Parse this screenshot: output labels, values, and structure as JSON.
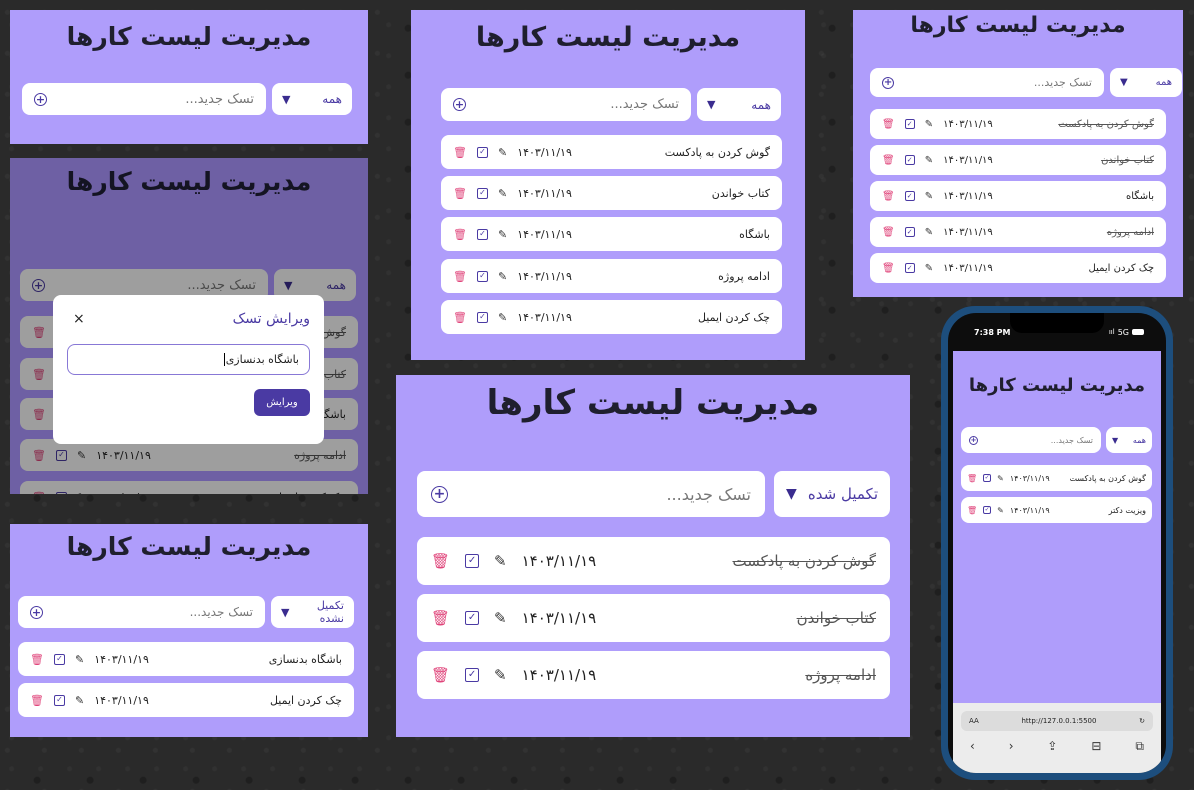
{
  "app_title": "مدیریت لیست کارها",
  "search": {
    "placeholder": "تسک جدید..."
  },
  "filters": {
    "all": "همه",
    "completed": "تکمیل شده",
    "not_completed": "تکمیل نشده"
  },
  "date": "۱۴۰۳/۱۱/۱۹",
  "caret": "▼",
  "tasks": {
    "podcast": "گوش کردن به پادکست",
    "book": "کتاب خواندن",
    "gym": "باشگاه",
    "project": "ادامه پروژه",
    "email": "چک کردن ایمیل",
    "bodybuilding": "باشگاه بدنسازی",
    "doctor": "ویزیت دکتر"
  },
  "modal": {
    "title": "ویرایش تسک",
    "close": "×",
    "input_value": "باشگاه بدنسازی",
    "submit": "ویرایش"
  },
  "phone": {
    "time": "7:38 PM",
    "signal": "5G",
    "url": "http://127.0.0.1:5500",
    "aa": "AA"
  },
  "icons": {
    "plus": "plus-circle-icon",
    "trash": "trash-icon",
    "edit": "edit-icon",
    "check": "checkbox-icon",
    "close": "close-icon"
  },
  "colors": {
    "panel": "#af9dfb",
    "accent": "#4a3aa3",
    "trash": "#e0457b",
    "phone_frame": "#1d4e7d"
  }
}
